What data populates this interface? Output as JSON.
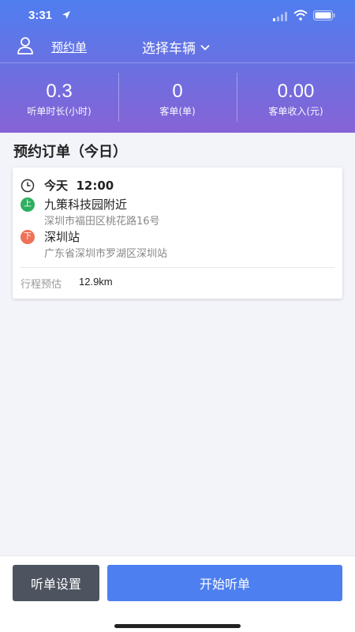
{
  "status_bar": {
    "time": "3:31"
  },
  "nav": {
    "orders_link": "预约单",
    "vehicle_select": "选择车辆"
  },
  "stats": [
    {
      "value": "0.3",
      "label": "听单时长(小时)"
    },
    {
      "value": "0",
      "label": "客单(单)"
    },
    {
      "value": "0.00",
      "label": "客单收入(元)"
    }
  ],
  "section_title": "预约订单（今日）",
  "order": {
    "datetime": "今天  12:00",
    "pickup_badge": "上",
    "pickup_name": "九策科技园附近",
    "pickup_address": "深圳市福田区桃花路16号",
    "dropoff_badge": "下",
    "dropoff_name": "深圳站",
    "dropoff_address": "广东省深圳市罗湖区深圳站",
    "distance_label": "行程预估",
    "distance_value": "12.9km"
  },
  "bottom": {
    "settings_label": "听单设置",
    "start_label": "开始听单"
  },
  "colors": {
    "primary": "#4d7ff0",
    "header_end": "#8663d6",
    "pickup": "#2eae5f",
    "dropoff": "#f07156",
    "settings_btn": "#4d5460"
  }
}
